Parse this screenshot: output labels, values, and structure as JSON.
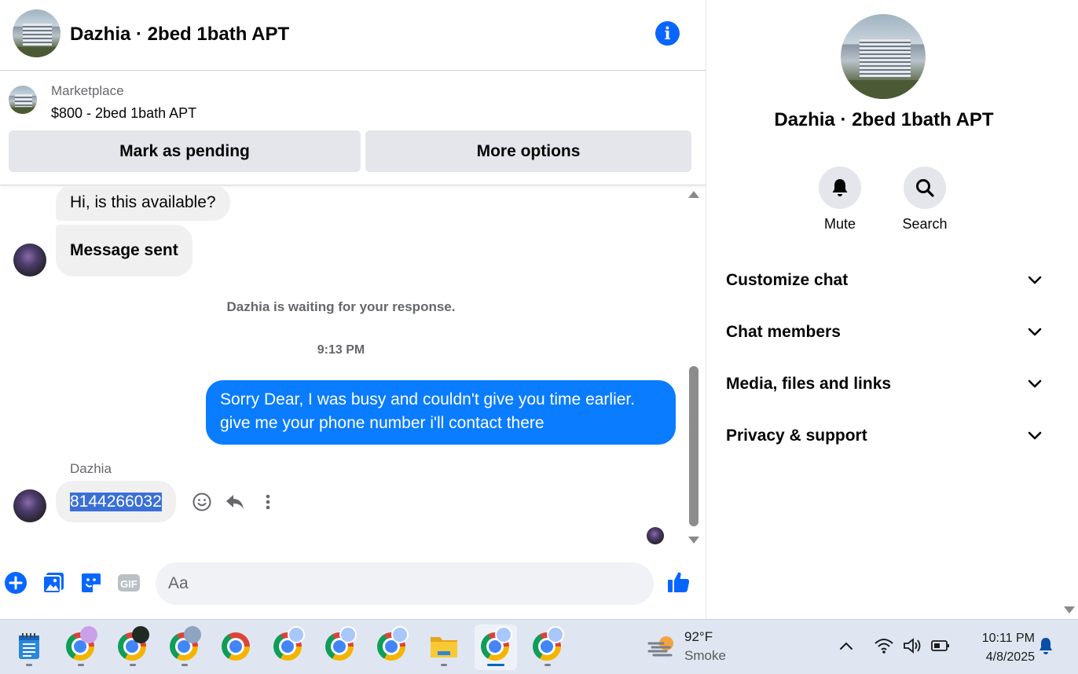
{
  "chat": {
    "title": "Dazhia · 2bed 1bath APT",
    "marketplace_label": "Marketplace",
    "listing": "$800 - 2bed 1bath APT",
    "mark_pending_label": "Mark as pending",
    "more_options_label": "More options",
    "messages": {
      "m1": "Hi, is this available?",
      "m2": "Message sent",
      "waiting_notice": "Dazhia is waiting for your response.",
      "timestamp": "9:13 PM",
      "outgoing_line1": "Sorry Dear, I was busy and couldn't give you time earlier.",
      "outgoing_line2": "give me your phone number i'll contact there",
      "sender_name": "Dazhia",
      "phone": "8144266032"
    },
    "composer_placeholder": "Aa"
  },
  "info_panel": {
    "title": "Dazhia · 2bed 1bath APT",
    "mute_label": "Mute",
    "search_label": "Search",
    "sections": {
      "customize": "Customize chat",
      "members": "Chat members",
      "media": "Media, files and links",
      "privacy": "Privacy & support"
    }
  },
  "taskbar": {
    "temperature": "92°F",
    "condition": "Smoke",
    "time": "10:11 PM",
    "date": "4/8/2025"
  },
  "colors": {
    "messenger_blue": "#0a7cff",
    "icon_blue": "#0866ff",
    "bubble_gray": "#f0f0f0",
    "button_gray": "#e4e6eb"
  },
  "icons": [
    "info-icon",
    "smile-icon",
    "reply-icon",
    "more-icon",
    "plus-icon",
    "image-icon",
    "sticker-icon",
    "gif-icon",
    "emoji-icon",
    "like-icon",
    "bell-icon",
    "search-icon",
    "chevron-down-icon",
    "wifi-icon",
    "volume-icon",
    "battery-icon",
    "notification-icon"
  ]
}
